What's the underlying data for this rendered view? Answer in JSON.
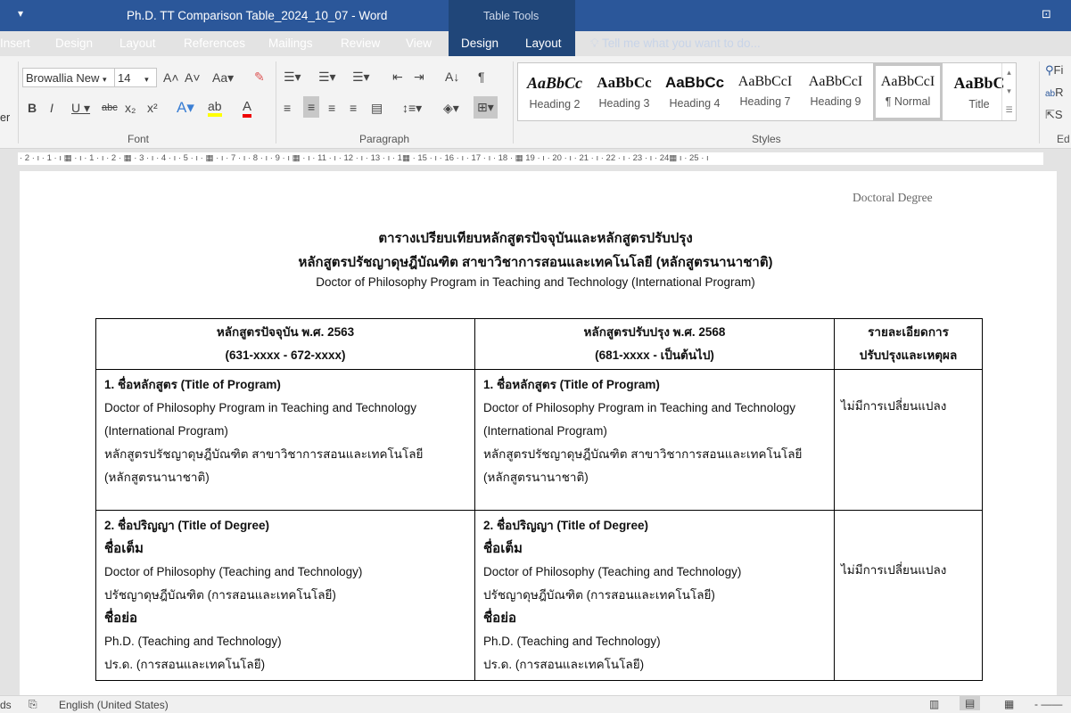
{
  "window": {
    "title": "Ph.D. TT Comparison Table_2024_10_07 - Word",
    "context_tab": "Table Tools",
    "quick_access": "▾"
  },
  "tabs": [
    "Insert",
    "Design",
    "Layout",
    "References",
    "Mailings",
    "Review",
    "View",
    "Design",
    "Layout"
  ],
  "tell_me": "Tell me what you want to do...",
  "ribbon": {
    "left_cut": "er",
    "font": {
      "name": "Browallia New",
      "size": "14",
      "group": "Font"
    },
    "paragraph": {
      "group": "Paragraph"
    },
    "styles": {
      "group": "Styles",
      "items": [
        {
          "sample": "AaBbCc",
          "label": "Heading 2"
        },
        {
          "sample": "AaBbCc",
          "label": "Heading 3"
        },
        {
          "sample": "AaBbCc",
          "label": "Heading 4"
        },
        {
          "sample": "AaBbCcI",
          "label": "Heading 7"
        },
        {
          "sample": "AaBbCcI",
          "label": "Heading 9"
        },
        {
          "sample": "AaBbCcI",
          "label": "¶ Normal"
        },
        {
          "sample": "AaBbC",
          "label": "Title"
        }
      ]
    },
    "editing": {
      "group": "Ed",
      "find": "Fi",
      "replace": "R",
      "select": "S"
    }
  },
  "ruler": "· 2 · ı · 1 · ı ▦   · ı · 1 · ı · 2 · ▦ · 3 · ı · 4 · ı · 5 · ı · ▦ · ı · 7 · ı · 8 · ı · 9 · ı  ▦ · ı · 11 · ı · 12 · ı · 13 · ı · 1▦ · 15 · ı · 16 · ı · 17 · ı · 18 · ▦ 19 · ı · 20 · ı · 21 · ı · 22 · ı · 23 · ı · 24▦ ı · 25 · ı",
  "document": {
    "header": "Doctoral Degree",
    "title1": "ตารางเปรียบเทียบหลักสูตรปัจจุบันและหลักสูตรปรับปรุง",
    "title2": "หลักสูตรปรัชญาดุษฎีบัณฑิต  สาขาวิชาการสอนและเทคโนโลยี (หลักสูตรนานาชาติ)",
    "title3": "Doctor of Philosophy Program in Teaching and Technology (International Program)",
    "table": {
      "headers": [
        {
          "l1": "หลักสูตรปัจจุบัน พ.ศ. 2563",
          "l2": "(631-xxxx - 672-xxxx)"
        },
        {
          "l1": "หลักสูตรปรับปรุง พ.ศ. 2568",
          "l2": "(681-xxxx - เป็นต้นไป)"
        },
        {
          "l1": "รายละเอียดการ",
          "l2": "ปรับปรุงและเหตุผล"
        }
      ],
      "row1": {
        "heading": "1. ชื่อหลักสูตร (Title of Program)",
        "en1": "Doctor of Philosophy Program in Teaching and Technology",
        "en2": "(International Program)",
        "th1": "หลักสูตรปรัชญาดุษฎีบัณฑิต  สาขาวิชาการสอนและเทคโนโลยี",
        "th2": "(หลักสูตรนานาชาติ)",
        "note": "ไม่มีการเปลี่ยนแปลง"
      },
      "row2": {
        "heading": "2. ชื่อปริญญา (Title of Degree)",
        "full": "ชื่อเต็ม",
        "full_en": "Doctor of Philosophy (Teaching and Technology)",
        "full_th": "ปรัชญาดุษฎีบัณฑิต  (การสอนและเทคโนโลยี)",
        "abbr": "ชื่อย่อ",
        "abbr_en": "Ph.D. (Teaching and Technology)",
        "abbr_th": "ปร.ด. (การสอนและเทคโนโลยี)",
        "note": "ไม่มีการเปลี่ยนแปลง"
      }
    }
  },
  "status": {
    "words": "ds",
    "language": "English (United States)"
  }
}
